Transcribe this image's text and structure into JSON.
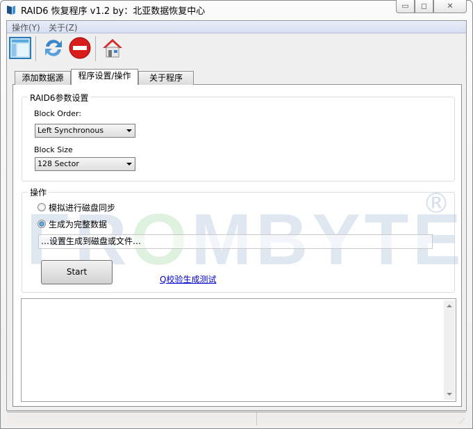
{
  "window": {
    "title": "RAID6 恢复程序 v1.2 by：北亚数据恢复中心",
    "minimize": "minimize",
    "maximize": "maximize",
    "close": "close"
  },
  "menu": [
    "操作(Y)",
    "关于(Z)"
  ],
  "toolbar": [
    {
      "icon": "layout-icon"
    },
    {
      "icon": "refresh-icon"
    },
    {
      "icon": "stop-icon"
    },
    {
      "icon": "home-icon"
    }
  ],
  "tabs": [
    {
      "label": "添加数据源",
      "active": false
    },
    {
      "label": "程序设置/操作",
      "active": true
    },
    {
      "label": "关于程序",
      "active": false
    }
  ],
  "raid_params": {
    "title": "RAID6参数设置",
    "block_order_label": "Block Order:",
    "block_order_value": "Left Synchronous",
    "block_size_label": "Block Size",
    "block_size_value": "128 Sector"
  },
  "operation": {
    "title": "操作",
    "radio1": "模拟进行磁盘同步",
    "radio1_checked": false,
    "radio2": "生成为完整数据",
    "radio2_checked": true,
    "path_placeholder": "…设置生成到磁盘或文件…",
    "start": "Start",
    "link": "Q校验生成测试"
  },
  "watermark": {
    "text": "FROMBYTE",
    "reg": "®"
  },
  "colors": {
    "link": "#0000cc",
    "menubar": "#dbe3f4"
  }
}
